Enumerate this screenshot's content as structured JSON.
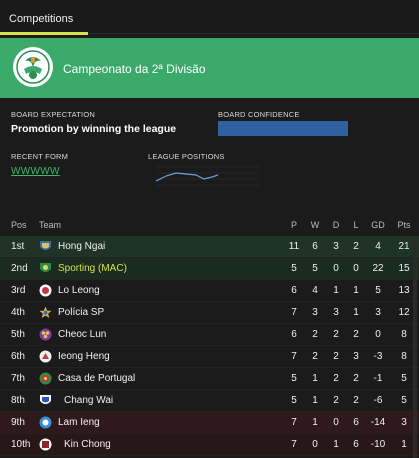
{
  "tabs": [
    {
      "label": "Competitions"
    }
  ],
  "competition": {
    "name": "Campeonato da 2ª Divisão"
  },
  "board": {
    "expectation_label": "BOARD EXPECTATION",
    "expectation_value": "Promotion by winning the league",
    "confidence_label": "BOARD CONFIDENCE"
  },
  "recent_form": {
    "label": "RECENT FORM",
    "value": "WWWWW"
  },
  "league_positions": {
    "label": "LEAGUE POSITIONS"
  },
  "table": {
    "headers": {
      "pos": "Pos",
      "team": "Team",
      "p": "P",
      "w": "W",
      "d": "D",
      "l": "L",
      "gd": "GD",
      "pts": "Pts"
    },
    "rows": [
      {
        "pos": "1st",
        "team": "Hong Ngai",
        "p": "11",
        "w": "6",
        "d": "3",
        "l": "2",
        "gd": "4",
        "pts": "21"
      },
      {
        "pos": "2nd",
        "team": "Sporting (MAC)",
        "p": "5",
        "w": "5",
        "d": "0",
        "l": "0",
        "gd": "22",
        "pts": "15"
      },
      {
        "pos": "3rd",
        "team": "Lo Leong",
        "p": "6",
        "w": "4",
        "d": "1",
        "l": "1",
        "gd": "5",
        "pts": "13"
      },
      {
        "pos": "4th",
        "team": "Polícia SP",
        "p": "7",
        "w": "3",
        "d": "3",
        "l": "1",
        "gd": "3",
        "pts": "12"
      },
      {
        "pos": "5th",
        "team": "Cheoc Lun",
        "p": "6",
        "w": "2",
        "d": "2",
        "l": "2",
        "gd": "0",
        "pts": "8"
      },
      {
        "pos": "6th",
        "team": "Ieong Heng",
        "p": "7",
        "w": "2",
        "d": "2",
        "l": "3",
        "gd": "-3",
        "pts": "8"
      },
      {
        "pos": "7th",
        "team": "Casa de Portugal",
        "p": "5",
        "w": "1",
        "d": "2",
        "l": "2",
        "gd": "-1",
        "pts": "5"
      },
      {
        "pos": "8th",
        "team": "Chang Wai",
        "p": "5",
        "w": "1",
        "d": "2",
        "l": "2",
        "gd": "-6",
        "pts": "5"
      },
      {
        "pos": "9th",
        "team": "Lam Ieng",
        "p": "7",
        "w": "1",
        "d": "0",
        "l": "6",
        "gd": "-14",
        "pts": "3"
      },
      {
        "pos": "10th",
        "team": "Kin Chong",
        "p": "7",
        "w": "0",
        "d": "1",
        "l": "6",
        "gd": "-10",
        "pts": "1"
      }
    ]
  },
  "colors": {
    "header_bg": "#3aa96a",
    "accent_yellow": "#d8e24a",
    "form_green": "#3fb86a",
    "confidence_blue": "#2f61a0",
    "positions_line": "#6f9fd8"
  }
}
